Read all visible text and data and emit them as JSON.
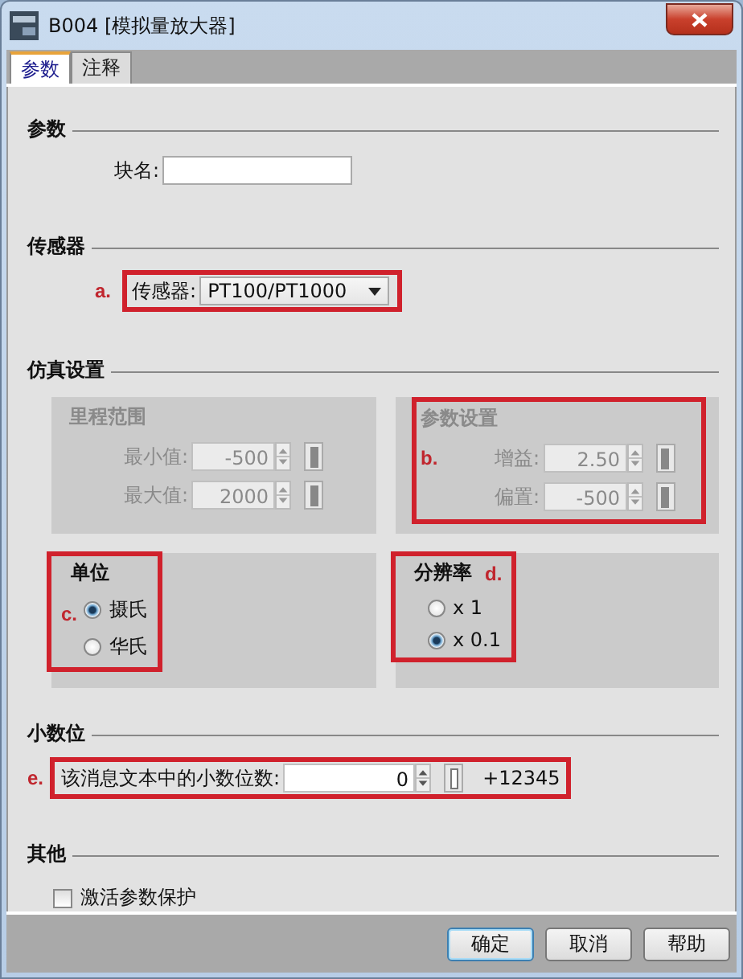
{
  "window": {
    "title": "B004 [模拟量放大器]"
  },
  "tabs": [
    {
      "label": "参数",
      "selected": true
    },
    {
      "label": "注释",
      "selected": false
    }
  ],
  "params": {
    "heading": "参数",
    "block_name_label": "块名:"
  },
  "sensor": {
    "heading": "传感器",
    "annotation": "a.",
    "label": "传感器:",
    "value": "PT100/PT1000"
  },
  "simulation": {
    "heading": "仿真设置",
    "panels": [
      {
        "title": "里程范围",
        "disabled": true,
        "fields": [
          {
            "label": "最小值:",
            "value": "-500"
          },
          {
            "label": "最大值:",
            "value": "2000"
          }
        ]
      },
      {
        "title": "参数设置",
        "disabled": true,
        "annotation": "b.",
        "fields": [
          {
            "label": "增益:",
            "value": "2.50"
          },
          {
            "label": "偏置:",
            "value": "-500"
          }
        ]
      }
    ]
  },
  "radio_groups": [
    {
      "title": "单位",
      "annotation": "c.",
      "kind": "left",
      "options": [
        {
          "label": "摄氏",
          "selected": true
        },
        {
          "label": "华氏",
          "selected": false
        }
      ]
    },
    {
      "title": "分辨率",
      "annotation": "d.",
      "kind": "titled",
      "options": [
        {
          "label": "x 1",
          "selected": false
        },
        {
          "label": "x 0.1",
          "selected": true
        }
      ]
    }
  ],
  "decimals": {
    "heading": "小数位",
    "annotation": "e.",
    "label": "该消息文本中的小数位数:",
    "value": "0",
    "preview": "+12345"
  },
  "other": {
    "heading": "其他",
    "checkbox": {
      "label": "激活参数保护",
      "checked": false
    }
  },
  "buttons": [
    {
      "label": "确定",
      "default": true
    },
    {
      "label": "取消",
      "default": false
    },
    {
      "label": "帮助",
      "default": false
    }
  ]
}
